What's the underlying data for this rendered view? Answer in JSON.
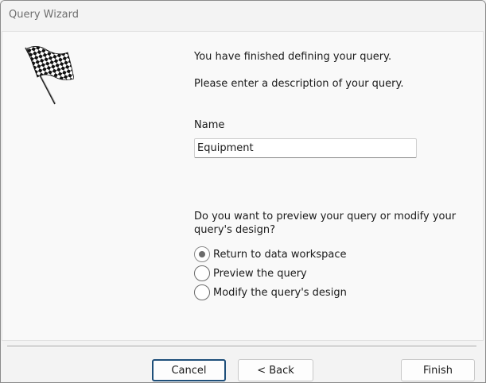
{
  "window": {
    "title": "Query Wizard"
  },
  "content": {
    "finished_message": "You have finished defining your query.",
    "enter_description": "Please enter a description of your query.",
    "name_label": "Name",
    "name_value": "Equipment",
    "preview_question": "Do you want to preview your query or modify your query's design?"
  },
  "options": {
    "return_label": "Return to data workspace",
    "preview_label": "Preview the query",
    "modify_label": "Modify the query's design",
    "selected": "Return to data workspace"
  },
  "buttons": {
    "cancel": "Cancel",
    "back": "< Back",
    "finish": "Finish"
  },
  "colors": {
    "default_button_border": "#1e4f7a"
  },
  "icons": {
    "flag": "checkered-flag-icon"
  }
}
